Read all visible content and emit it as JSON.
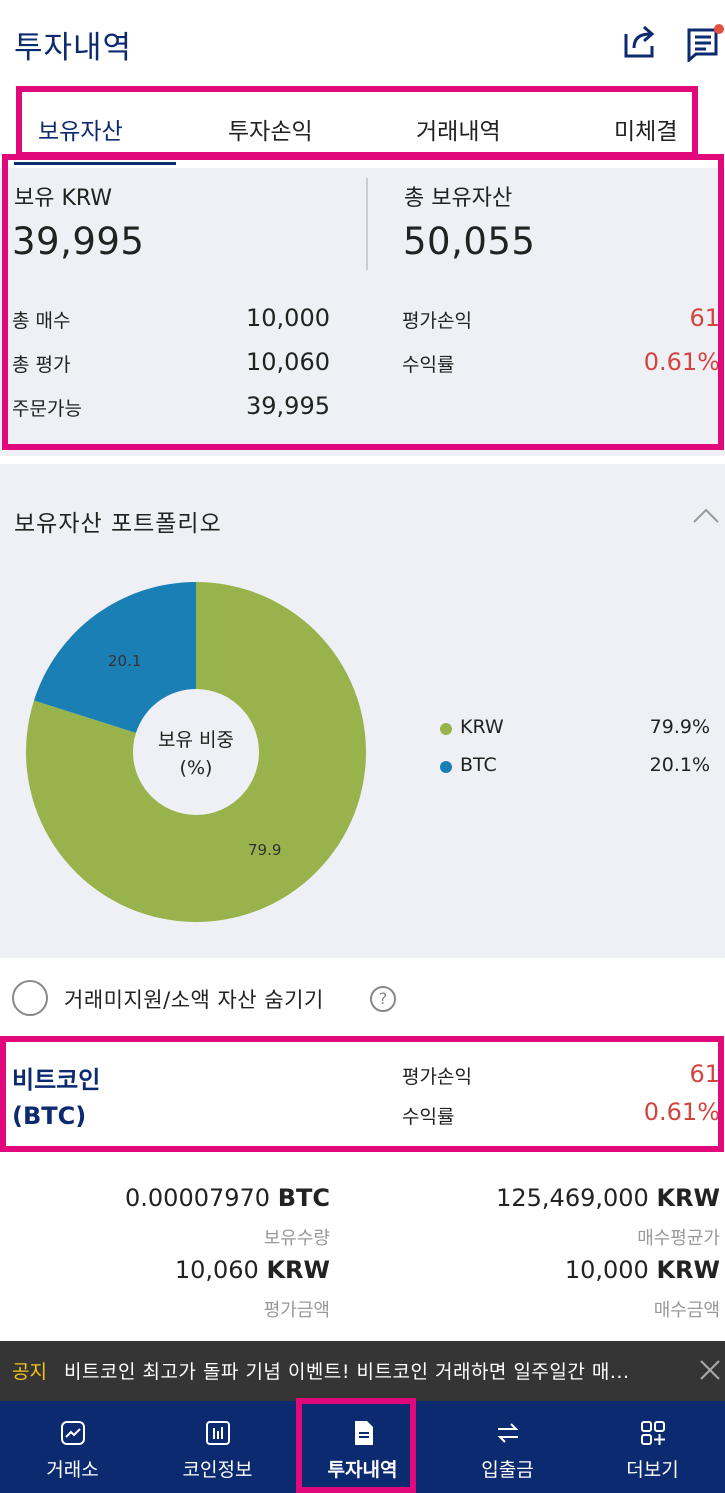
{
  "header": {
    "title": "투자내역",
    "share_icon": "share-icon",
    "notice_icon": "notice-list-icon"
  },
  "tabs": [
    {
      "label": "보유자산",
      "active": true
    },
    {
      "label": "투자손익",
      "active": false
    },
    {
      "label": "거래내역",
      "active": false
    },
    {
      "label": "미체결",
      "active": false
    }
  ],
  "summary": {
    "krw_label": "보유 KRW",
    "krw_value": "39,995",
    "total_label": "총 보유자산",
    "total_value": "50,055",
    "buy_label": "총 매수",
    "buy_value": "10,000",
    "eval_label": "총 평가",
    "eval_value": "10,060",
    "orderable_label": "주문가능",
    "orderable_value": "39,995",
    "pnl_label": "평가손익",
    "pnl_value": "61",
    "return_label": "수익률",
    "return_value": "0.61%"
  },
  "portfolio": {
    "title": "보유자산 포트폴리오",
    "center_line1": "보유 비중",
    "center_line2": "(%)"
  },
  "chart_data": {
    "type": "pie",
    "categories": [
      "KRW",
      "BTC"
    ],
    "values": [
      79.9,
      20.1
    ],
    "slice_labels": [
      "79.9",
      "20.1"
    ],
    "legend_pcts": [
      "79.9%",
      "20.1%"
    ],
    "colors": [
      "#98b34b",
      "#1a7fb5"
    ],
    "title": "",
    "legend": "right"
  },
  "hide_option": {
    "label": "거래미지원/소액 자산 숨기기",
    "help": "?"
  },
  "coin": {
    "name_line1": "비트코인",
    "name_line2": "(BTC)",
    "pnl_label": "평가손익",
    "pnl_value": "61",
    "return_label": "수익률",
    "return_value": "0.61%"
  },
  "detail": {
    "holding_amount": "0.00007970",
    "holding_unit": "BTC",
    "holding_label": "보유수량",
    "avg_price": "125,469,000",
    "avg_unit": "KRW",
    "avg_label": "매수평균가",
    "eval_amount": "10,060",
    "eval_unit": "KRW",
    "eval_label": "평가금액",
    "buy_amount": "10,000",
    "buy_unit": "KRW",
    "buy_label": "매수금액"
  },
  "notice": {
    "tag": "공지",
    "text": "비트코인 최고가 돌파 기념 이벤트! 비트코인 거래하면 일주일간 매..."
  },
  "bottom_nav": [
    {
      "label": "거래소",
      "icon": "exchange-chart-icon",
      "active": false
    },
    {
      "label": "코인정보",
      "icon": "coin-info-icon",
      "active": false
    },
    {
      "label": "투자내역",
      "icon": "document-icon",
      "active": true
    },
    {
      "label": "입출금",
      "icon": "transfer-arrows-icon",
      "active": false
    },
    {
      "label": "더보기",
      "icon": "more-grid-icon",
      "active": false
    }
  ],
  "colors": {
    "brand": "#0b2a6f",
    "highlight": "#e0087a",
    "profit": "#d2453f",
    "notice_tag": "#f5c518"
  }
}
